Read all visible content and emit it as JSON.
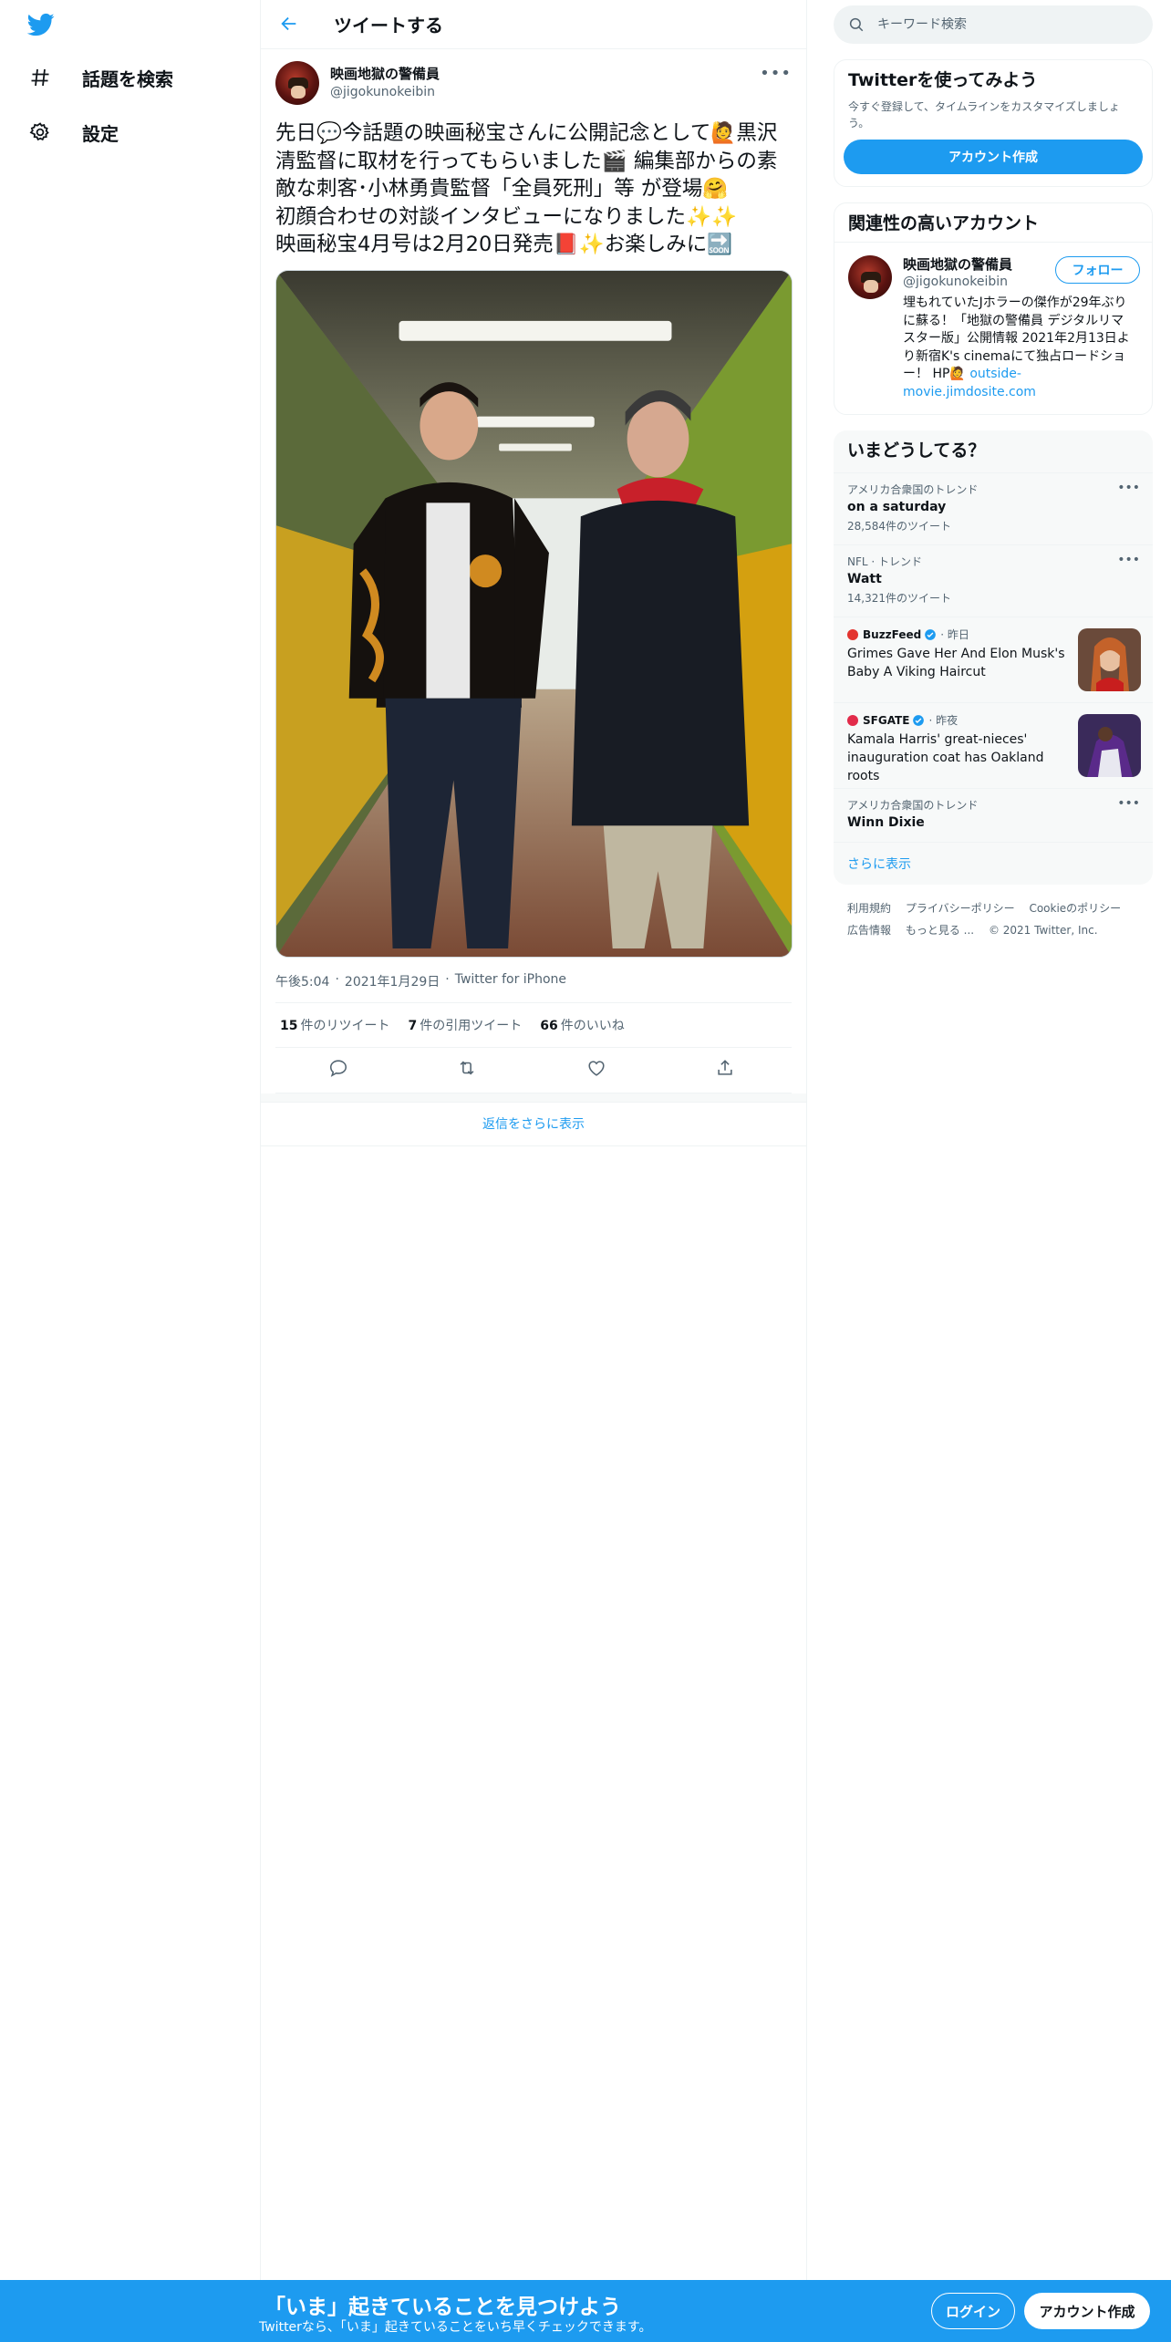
{
  "nav": {
    "logo": "twitter-logo",
    "items": [
      {
        "label": "話題を検索",
        "icon": "hashtag-icon"
      },
      {
        "label": "設定",
        "icon": "gear-icon"
      }
    ]
  },
  "header": {
    "title": "ツイートする"
  },
  "tweet": {
    "display_name": "映画地獄の警備員",
    "handle": "@jigokunokeibin",
    "text": "先日💬今話題の映画秘宝さんに公開記念として🙋黒沢 清監督に取材を行ってもらいました🎬 編集部からの素敵な刺客･小林勇貴監督「全員死刑」等 が登場🤗\n初顔合わせの対談インタビューになりました✨✨\n映画秘宝4月号は2月20日発売📕✨お楽しみに🔜",
    "time": "午後5:04",
    "date": "2021年1月29日",
    "source": "Twitter for iPhone",
    "stats": {
      "retweets": "15",
      "retweets_label": "件のリツイート",
      "quotes": "7",
      "quotes_label": "件の引用ツイート",
      "likes": "66",
      "likes_label": "件のいいね"
    },
    "show_more_replies": "返信をさらに表示"
  },
  "sidebar": {
    "search_placeholder": "キーワード検索",
    "signup": {
      "title": "Twitterを使ってみよう",
      "sub": "今すぐ登録して、タイムラインをカスタマイズしましょう。",
      "button": "アカウント作成"
    },
    "relevant": {
      "title": "関連性の高いアカウント",
      "name": "映画地獄の警備員",
      "handle": "@jigokunokeibin",
      "follow": "フォロー",
      "bio": "埋もれていたJホラーの傑作が29年ぶりに蘇る！「地獄の警備員 デジタルリマスター版」公開情報 2021年2月13日より新宿K's cinemaにて独占ロードショー！ HP🙋",
      "link": "outside-movie.jimdosite.com"
    },
    "trends": {
      "title": "いまどうしてる？",
      "items": [
        {
          "context": "アメリカ合衆国のトレンド",
          "name": "on a saturday",
          "count": "28,584件のツイート"
        },
        {
          "context": "NFL · トレンド",
          "name": "Watt",
          "count": "14,321件のツイート"
        }
      ],
      "news": [
        {
          "source": "BuzzFeed",
          "time": "· 昨日",
          "headline": "Grimes Gave Her And Elon Musk's Baby A Viking Haircut"
        },
        {
          "source": "SFGATE",
          "time": "· 昨夜",
          "headline": "Kamala Harris' great-nieces' inauguration coat has Oakland roots"
        }
      ],
      "last": {
        "context": "アメリカ合衆国のトレンド",
        "name": "Winn Dixie"
      },
      "show_more": "さらに表示"
    },
    "footer": {
      "links": [
        "利用規約",
        "プライバシーポリシー",
        "Cookieのポリシー",
        "広告情報",
        "もっと見る ..."
      ],
      "copyright": "© 2021 Twitter, Inc."
    }
  },
  "bottom": {
    "headline": "「いま」起きていることを見つけよう",
    "sub": "Twitterなら、「いま」起きていることをいち早くチェックできます。",
    "login": "ログイン",
    "signup": "アカウント作成"
  },
  "colors": {
    "accent": "#1d9bf0",
    "text": "#0f1419",
    "muted": "#536471"
  }
}
